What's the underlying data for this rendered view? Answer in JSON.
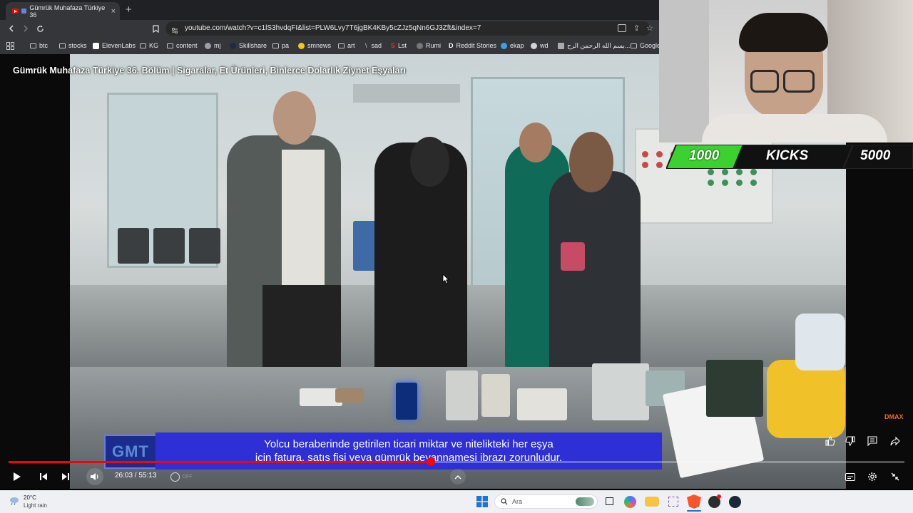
{
  "browser": {
    "tab_title": "Gümrük Muhafaza Türkiye 36",
    "tab_close": "×",
    "new_tab": "+",
    "url": "youtube.com/watch?v=c1lS3hvdqFI&list=PLW6Lvy7T6jgBK4KBy5cZJz5qNn6GJ3Zft&index=7",
    "bookmarks": [
      "btc",
      "stocks",
      "ElevenLabs",
      "KG",
      "content",
      "mj",
      "Skillshare",
      "pa",
      "smnews",
      "art",
      "sad",
      "Lst",
      "Rumi",
      "Reddit Stories",
      "ekap",
      "wd",
      "بسم الله الرحمن الرح...",
      "Google"
    ]
  },
  "video": {
    "title": "Gümrük Muhafaza Türkiye 36. Bölüm | Sigaralar, Et Ürünleri, Binlerce Dolarlık Ziynet Eşyaları",
    "subtitle_line1": "Yolcu beraberinde getirilen ticari miktar ve nitelikteki her eşya",
    "subtitle_line2": "için fatura, satış fişi veya gümrük beyannamesi ibrazı zorunludur.",
    "channel_logo": "GMT",
    "watermark": "DMAX",
    "current_time": "26:03",
    "duration": "55:13",
    "time_display": "26:03 / 55:13",
    "progress_fraction": 0.4717,
    "autoplay_label": "OFF"
  },
  "overlay": {
    "left_number": "1000",
    "center_label": "KICKS",
    "right_number": "5000"
  },
  "taskbar": {
    "weather_temp": "20°C",
    "weather_desc": "Light rain",
    "search_placeholder": "Ara"
  },
  "colors": {
    "progress": "#ff0000",
    "subtitle_bg": "#2f2fd6",
    "kicks_green": "#3bd12e"
  }
}
